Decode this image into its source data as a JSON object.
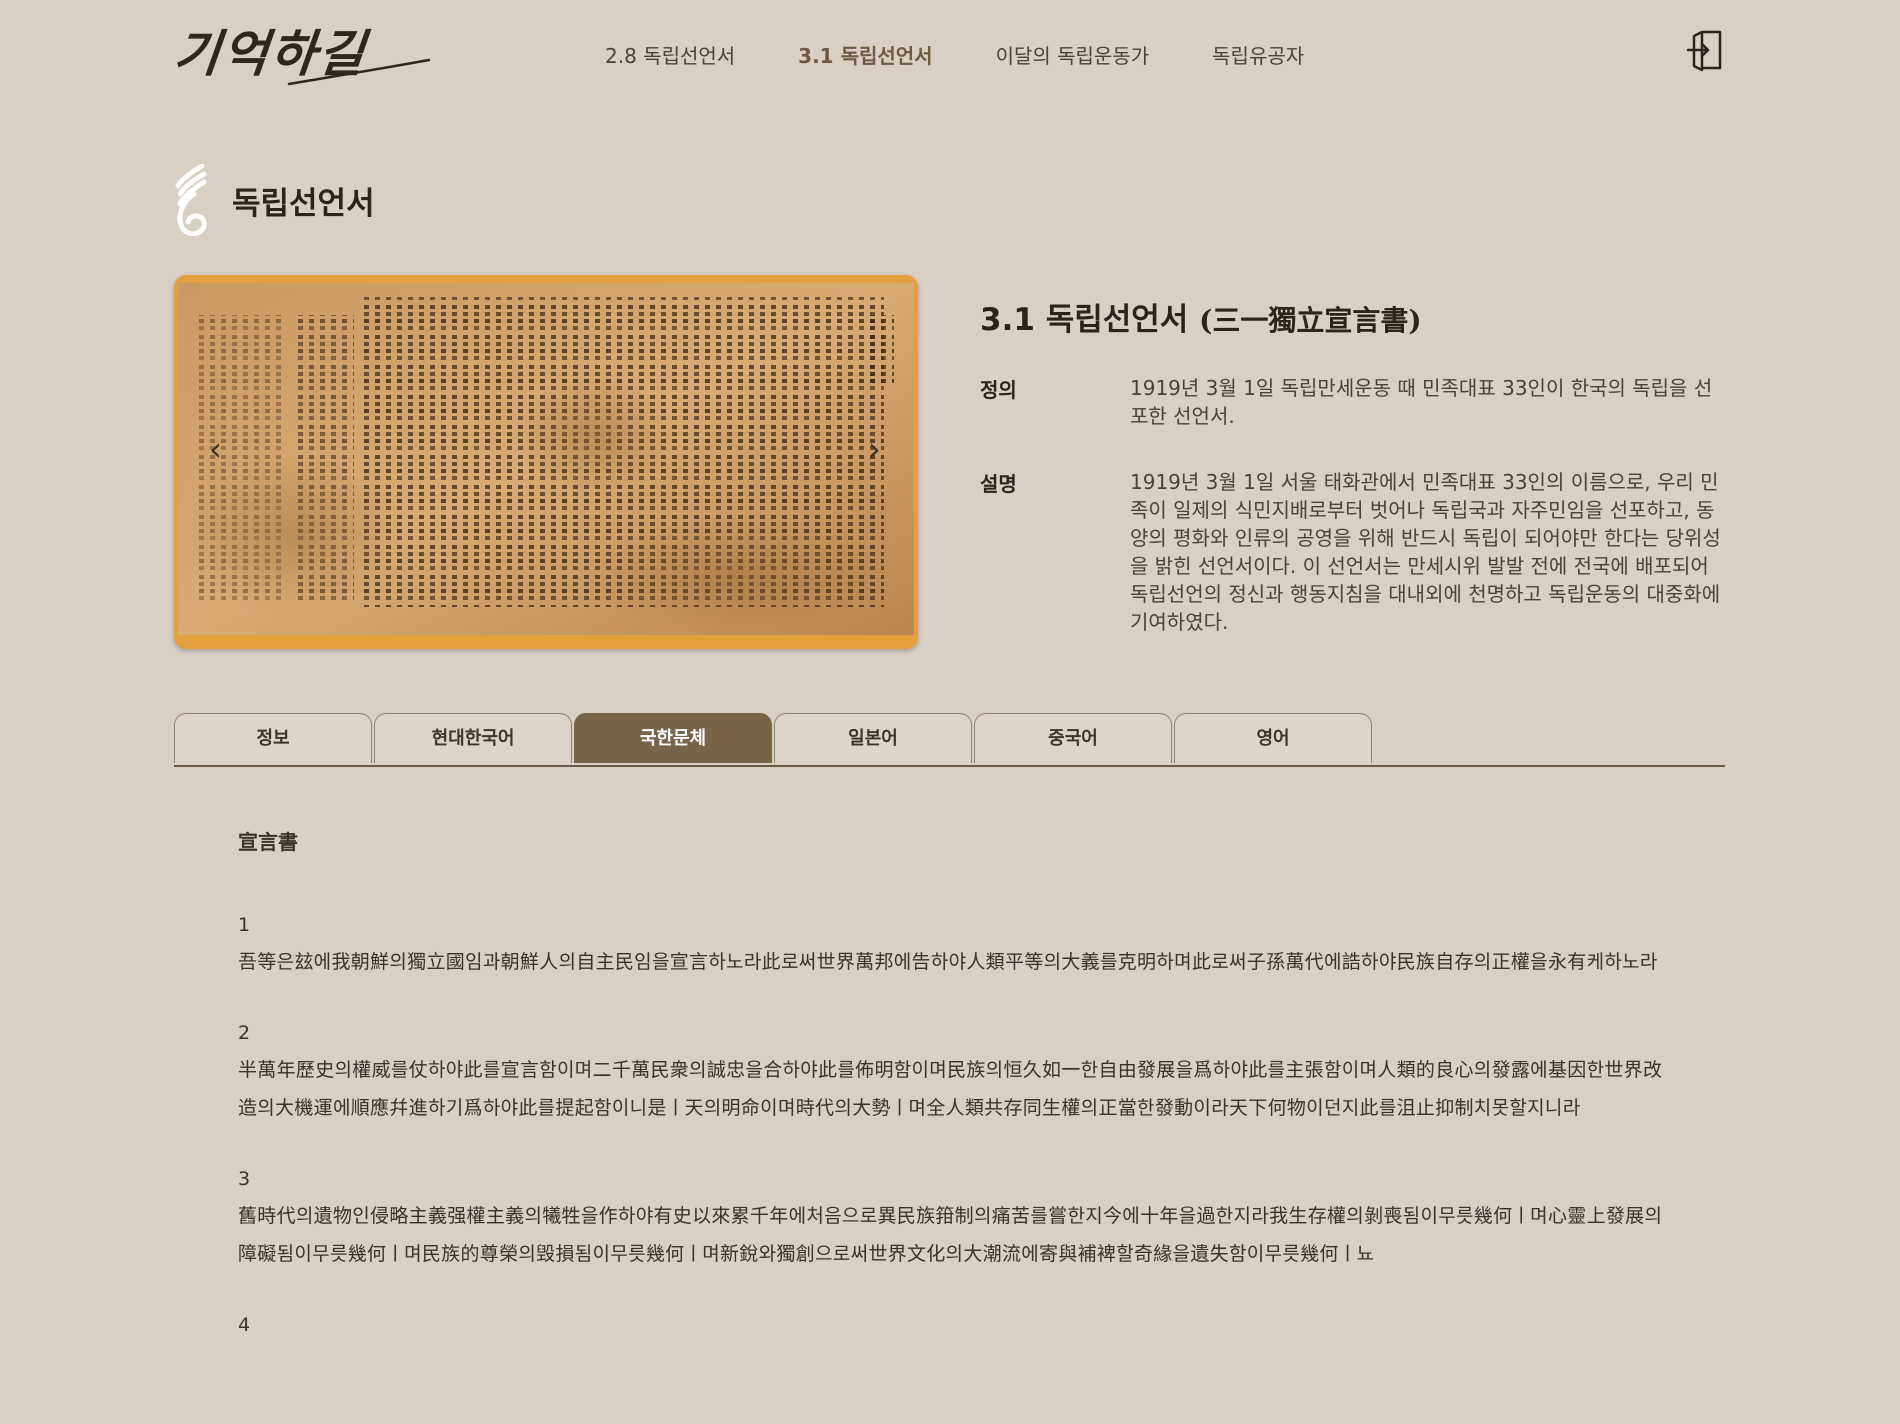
{
  "header": {
    "logo_text": "기억하길",
    "nav": [
      {
        "label": "2.8 독립선언서",
        "active": false
      },
      {
        "label": "3.1 독립선언서",
        "active": true
      },
      {
        "label": "이달의 독립운동가",
        "active": false
      },
      {
        "label": "독립유공자",
        "active": false
      }
    ],
    "login_icon": "login-icon"
  },
  "section": {
    "title": "독립선언서",
    "icon": "brush-stroke-icon"
  },
  "carousel": {
    "image_alt": "宣言書",
    "prev_icon": "chevron-left-icon",
    "next_icon": "chevron-right-icon",
    "slide_count": 3,
    "active_slide": 1
  },
  "document": {
    "title_ko": "3.1 독립선언서",
    "title_han": "(三一獨立宣言書)",
    "definition_label": "정의",
    "definition_text": "1919년 3월 1일 독립만세운동 때 민족대표 33인이 한국의 독립을 선포한 선언서.",
    "description_label": "설명",
    "description_text": "1919년 3월 1일 서울 태화관에서 민족대표 33인의 이름으로, 우리 민족이 일제의 식민지배로부터 벗어나 독립국과 자주민임을 선포하고, 동양의 평화와 인류의 공영을 위해 반드시 독립이 되어야만 한다는 당위성을 밝힌 선언서이다. 이 선언서는 만세시위 발발 전에 전국에 배포되어 독립선언의 정신과 행동지침을 대내외에 천명하고 독립운동의 대중화에 기여하였다."
  },
  "tabs": [
    {
      "label": "정보",
      "active": false
    },
    {
      "label": "현대한국어",
      "active": false
    },
    {
      "label": "국한문체",
      "active": true
    },
    {
      "label": "일본어",
      "active": false
    },
    {
      "label": "중국어",
      "active": false
    },
    {
      "label": "영어",
      "active": false
    }
  ],
  "content": {
    "heading": "宣言書",
    "paragraphs": [
      {
        "num": "1",
        "text": "吾等은玆에我朝鮮의獨立國임과朝鮮人의自主民임을宣言하노라此로써世界萬邦에告하야人類平等의大義를克明하며此로써子孫萬代에誥하야民族自存의正權을永有케하노라"
      },
      {
        "num": "2",
        "text": "半萬年歷史의權威를仗하야此를宣言함이며二千萬民衆의誠忠을合하야此를佈明함이며民族의恒久如一한自由發展을爲하야此를主張함이며人類的良心의發露에基因한世界改造의大機運에順應幷進하기爲하야此를提起함이니是ㅣ天의明命이며時代의大勢ㅣ며全人類共存同生權의正當한發動이라天下何物이던지此를沮止抑制치못할지니라"
      },
      {
        "num": "3",
        "text": "舊時代의遺物인侵略主義强權主義의犧牲을作하야有史以來累千年에처음으로異民族箝制의痛苦를嘗한지今에十年을過한지라我生存權의剝喪됨이무릇幾何ㅣ며心靈上發展의障礙됨이무릇幾何ㅣ며民族的尊榮의毁損됨이무릇幾何ㅣ며新銳와獨創으로써世界文化의大潮流에寄與補裨할奇緣을遺失함이무릇幾何ㅣ뇨"
      },
      {
        "num": "4",
        "text": ""
      }
    ]
  },
  "colors": {
    "background": "#d8d0c4",
    "accent": "#7a6448",
    "text": "#3a3128"
  }
}
